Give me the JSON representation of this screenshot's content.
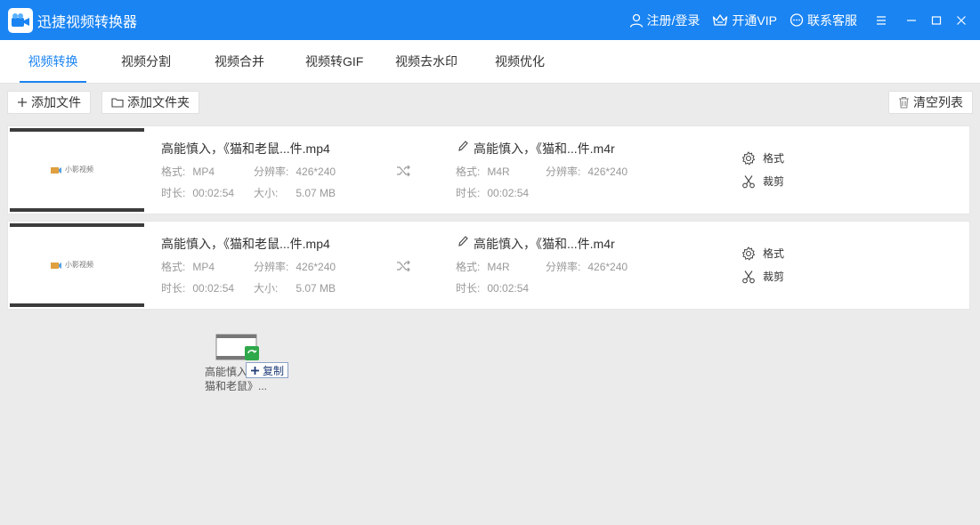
{
  "app": {
    "title": "迅捷视频转换器"
  },
  "titlebar": {
    "login": "注册/登录",
    "vip": "开通VIP",
    "service": "联系客服"
  },
  "tabs": [
    "视频转换",
    "视频分割",
    "视频合并",
    "视频转GIF",
    "视频去水印",
    "视频优化"
  ],
  "toolbar": {
    "add_file": "添加文件",
    "add_folder": "添加文件夹",
    "clear_list": "清空列表"
  },
  "files": [
    {
      "input_name": "高能慎入，《猫和老鼠...件.mp4",
      "input_format": "MP4",
      "input_resolution": "426*240",
      "input_duration": "00:02:54",
      "input_size": "5.07 MB",
      "output_name": "高能慎入，《猫和...件.m4r",
      "output_format": "M4R",
      "output_resolution": "426*240",
      "output_duration": "00:02:54"
    },
    {
      "input_name": "高能慎入，《猫和老鼠...件.mp4",
      "input_format": "MP4",
      "input_resolution": "426*240",
      "input_duration": "00:02:54",
      "input_size": "5.07 MB",
      "output_name": "高能慎入，《猫和...件.m4r",
      "output_format": "M4R",
      "output_resolution": "426*240",
      "output_duration": "00:02:54"
    }
  ],
  "labels": {
    "format": "格式:",
    "resolution": "分辨率:",
    "duration": "时长:",
    "size": "大小:",
    "format_action": "格式",
    "trim_action": "裁剪",
    "watermark": "小影视频"
  },
  "drag": {
    "copy_label": "复制",
    "file_label_1": "高能慎入",
    "file_label_2": "猫和老鼠》..."
  },
  "colors": {
    "accent": "#1a84f2",
    "titlebar": "#1a84f2"
  }
}
